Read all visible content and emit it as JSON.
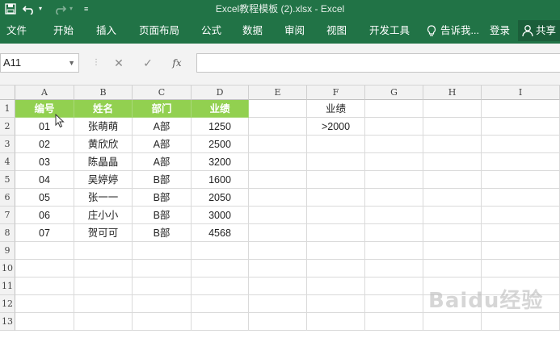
{
  "window": {
    "title": "Excel教程模板 (2).xlsx - Excel",
    "undo_icon": "undo-icon",
    "redo_icon": "redo-icon",
    "customize_icon": "customize-icon"
  },
  "ribbon": {
    "tabs": [
      "文件",
      "开始",
      "插入",
      "页面布局",
      "公式",
      "数据",
      "审阅",
      "视图",
      "开发工具"
    ],
    "tell_me": "告诉我...",
    "signin": "登录",
    "share": "共享"
  },
  "formula_bar": {
    "name_box": "A11",
    "cancel_symbol": "✕",
    "enter_symbol": "✓",
    "fx_symbol": "fx",
    "value": ""
  },
  "sheet": {
    "columns": [
      "A",
      "B",
      "C",
      "D",
      "E",
      "F",
      "G",
      "H",
      "I"
    ],
    "rows": [
      "1",
      "2",
      "3",
      "4",
      "5",
      "6",
      "7",
      "8",
      "9",
      "10",
      "11",
      "12",
      "13"
    ],
    "header": [
      "编号",
      "姓名",
      "部门",
      "业绩"
    ],
    "data": [
      [
        "01",
        "张萌萌",
        "A部",
        "1250"
      ],
      [
        "02",
        "黄欣欣",
        "A部",
        "2500"
      ],
      [
        "03",
        "陈晶晶",
        "A部",
        "3200"
      ],
      [
        "04",
        "吴婷婷",
        "B部",
        "1600"
      ],
      [
        "05",
        "张一一",
        "B部",
        "2050"
      ],
      [
        "06",
        "庄小小",
        "B部",
        "3000"
      ],
      [
        "07",
        "贺可可",
        "B部",
        "4568"
      ]
    ],
    "criteria_header": "业绩",
    "criteria_value": ">2000"
  },
  "watermark": "Baidu经验",
  "colors": {
    "ribbon_green": "#217346",
    "header_fill": "#92d050"
  }
}
